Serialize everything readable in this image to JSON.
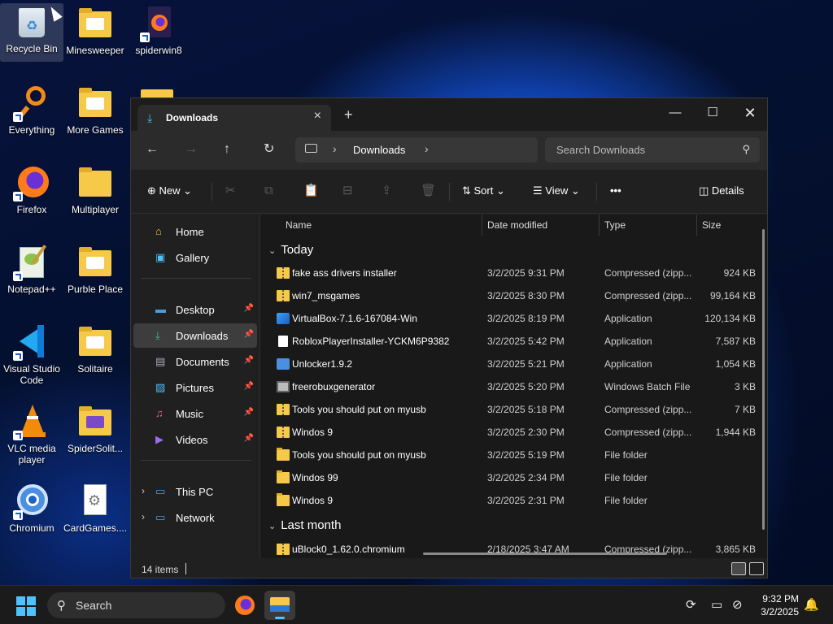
{
  "desktop": {
    "icons": [
      {
        "label": "Recycle Bin"
      },
      {
        "label": "Minesweeper"
      },
      {
        "label": "spiderwin8"
      },
      {
        "label": "Everything"
      },
      {
        "label": "More Games"
      },
      {
        "label": "Firefox"
      },
      {
        "label": "Multiplayer"
      },
      {
        "label": "Notepad++"
      },
      {
        "label": "Purble Place"
      },
      {
        "label": "Visual Studio Code"
      },
      {
        "label": "Solitaire"
      },
      {
        "label": "VLC media player"
      },
      {
        "label": "SpiderSolit..."
      },
      {
        "label": "Chromium"
      },
      {
        "label": "CardGames...."
      }
    ]
  },
  "explorer": {
    "tab_title": "Downloads",
    "new_tab": "+",
    "address": {
      "crumb": "Downloads"
    },
    "search_placeholder": "Search Downloads",
    "commands": {
      "new": "New",
      "sort": "Sort",
      "view": "View",
      "more": "•••",
      "details": "Details"
    },
    "sidebar": {
      "home": "Home",
      "gallery": "Gallery",
      "desktop": "Desktop",
      "downloads": "Downloads",
      "documents": "Documents",
      "pictures": "Pictures",
      "music": "Music",
      "videos": "Videos",
      "this_pc": "This PC",
      "network": "Network"
    },
    "columns": {
      "name": "Name",
      "date": "Date modified",
      "type": "Type",
      "size": "Size"
    },
    "groups": {
      "today": "Today",
      "last_month": "Last month"
    },
    "files": [
      {
        "name": "fake ass drivers installer",
        "date": "3/2/2025 9:31 PM",
        "type": "Compressed (zipp...",
        "size": "924 KB",
        "icon": "zip"
      },
      {
        "name": "win7_msgames",
        "date": "3/2/2025 8:30 PM",
        "type": "Compressed (zipp...",
        "size": "99,164 KB",
        "icon": "zip"
      },
      {
        "name": "VirtualBox-7.1.6-167084-Win",
        "date": "3/2/2025 8:19 PM",
        "type": "Application",
        "size": "120,134 KB",
        "icon": "vbox"
      },
      {
        "name": "RobloxPlayerInstaller-YCKM6P9382",
        "date": "3/2/2025 5:42 PM",
        "type": "Application",
        "size": "7,587 KB",
        "icon": "doc"
      },
      {
        "name": "Unlocker1.9.2",
        "date": "3/2/2025 5:21 PM",
        "type": "Application",
        "size": "1,054 KB",
        "icon": "app"
      },
      {
        "name": "freerobuxgenerator",
        "date": "3/2/2025 5:20 PM",
        "type": "Windows Batch File",
        "size": "3 KB",
        "icon": "bat"
      },
      {
        "name": "Tools you should put on myusb",
        "date": "3/2/2025 5:18 PM",
        "type": "Compressed (zipp...",
        "size": "7 KB",
        "icon": "zip"
      },
      {
        "name": "Windos 9",
        "date": "3/2/2025 2:30 PM",
        "type": "Compressed (zipp...",
        "size": "1,944 KB",
        "icon": "zip"
      },
      {
        "name": "Tools you should put on myusb",
        "date": "3/2/2025 5:19 PM",
        "type": "File folder",
        "size": "",
        "icon": "folder"
      },
      {
        "name": "Windos 99",
        "date": "3/2/2025 2:34 PM",
        "type": "File folder",
        "size": "",
        "icon": "folder"
      },
      {
        "name": "Windos 9",
        "date": "3/2/2025 2:31 PM",
        "type": "File folder",
        "size": "",
        "icon": "folder"
      }
    ],
    "last_month_files": [
      {
        "name": "uBlock0_1.62.0.chromium",
        "date": "2/18/2025 3:47 AM",
        "type": "Compressed (zipp...",
        "size": "3,865 KB",
        "icon": "zip"
      }
    ],
    "status_count": "14 items"
  },
  "taskbar": {
    "search_label": "Search",
    "time": "9:32 PM",
    "date": "3/2/2025",
    "accent": "#4cc2ff"
  }
}
